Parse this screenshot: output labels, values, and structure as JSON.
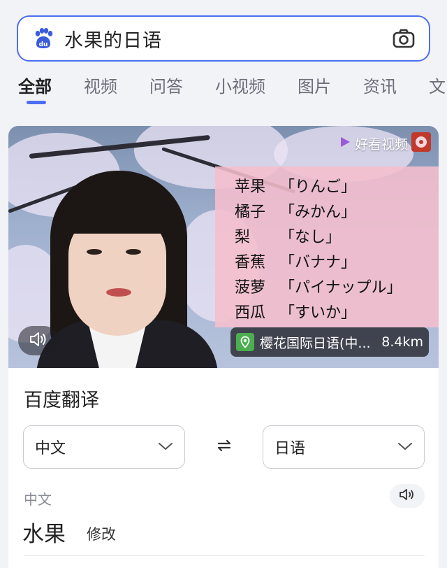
{
  "search": {
    "query": "水果的日语",
    "logo_icon": "baidu-paw-icon",
    "camera_icon": "camera-icon"
  },
  "tabs": [
    {
      "label": "全部",
      "active": true
    },
    {
      "label": "视频",
      "active": false
    },
    {
      "label": "问答",
      "active": false
    },
    {
      "label": "小视频",
      "active": false
    },
    {
      "label": "图片",
      "active": false
    },
    {
      "label": "资讯",
      "active": false
    },
    {
      "label": "文",
      "active": false
    }
  ],
  "video": {
    "watermark": "好看视频",
    "words": [
      {
        "cn": "苹果",
        "jp": "「りんご」"
      },
      {
        "cn": "橘子",
        "jp": "「みかん」"
      },
      {
        "cn": "梨",
        "jp": "「なし」"
      },
      {
        "cn": "香蕉",
        "jp": "「バナナ」"
      },
      {
        "cn": "菠萝",
        "jp": "「パイナップル」"
      },
      {
        "cn": "西瓜",
        "jp": "「すいか」"
      }
    ],
    "location_name": "樱花国际日语(中...",
    "location_distance": "8.4km"
  },
  "translate": {
    "title": "百度翻译",
    "source_lang": "中文",
    "target_lang": "日语",
    "source_label": "中文",
    "source_text": "水果",
    "edit_label": "修改"
  },
  "colors": {
    "accent": "#4e6ef2",
    "background": "#f2f3f7",
    "location_badge": "#4cae4f"
  }
}
